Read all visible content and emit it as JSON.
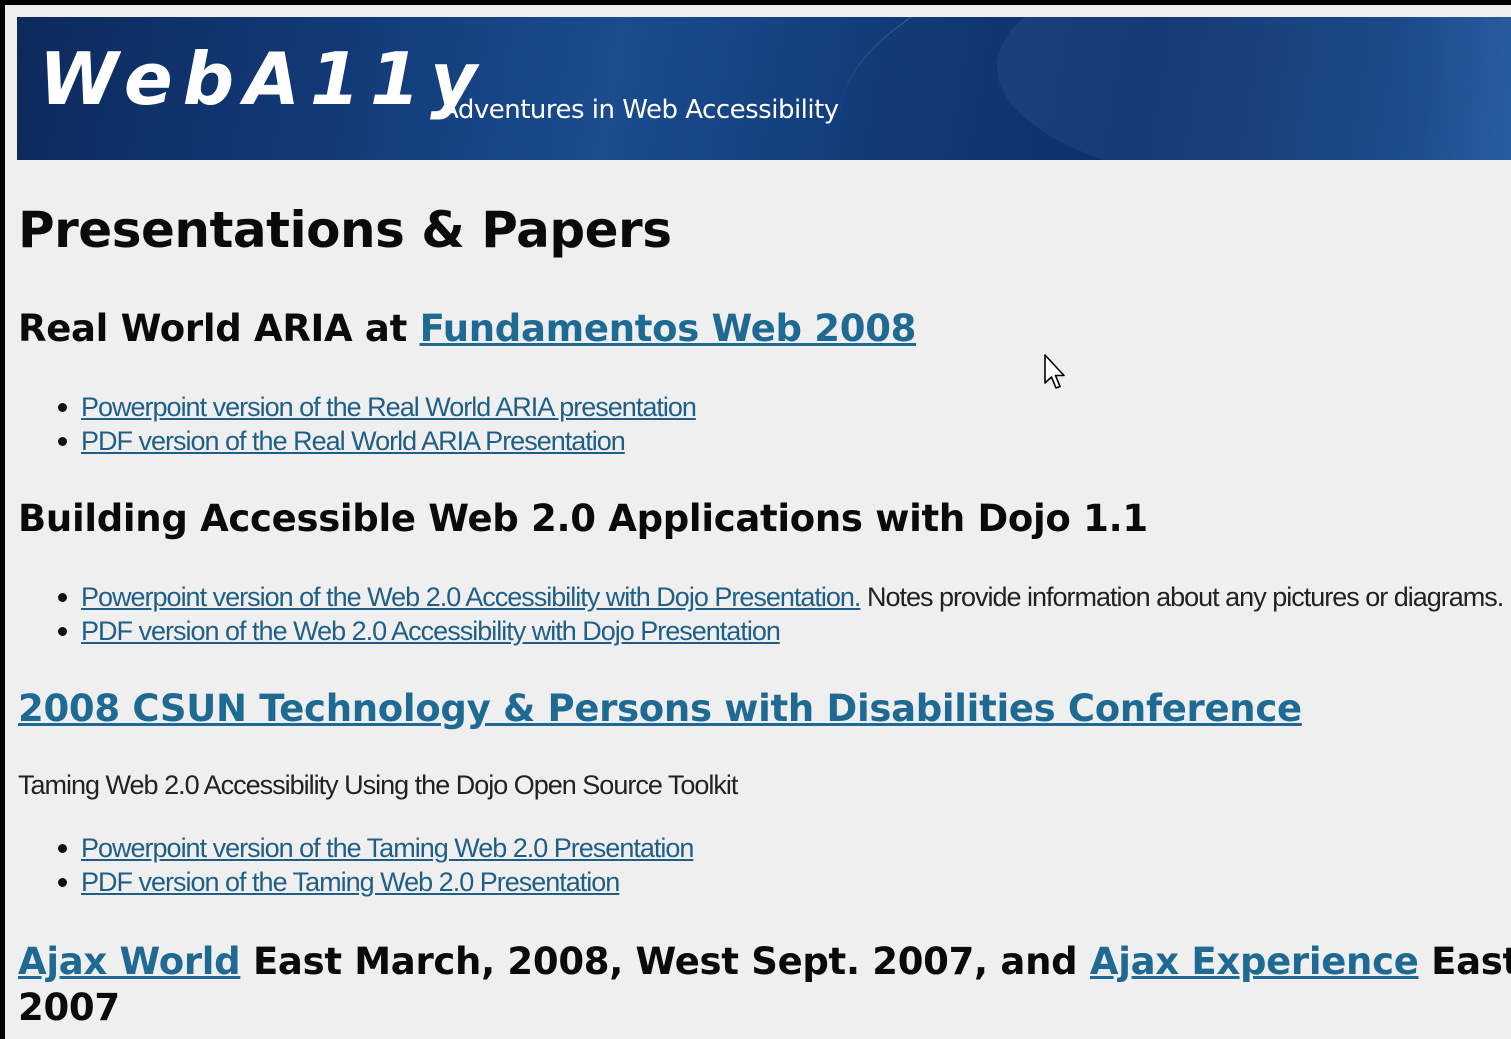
{
  "header": {
    "logo_text": "WebA11y",
    "tagline": "Adventures in Web Accessibility"
  },
  "page_title": "Presentations & Papers",
  "sections": [
    {
      "heading_prefix": "Real World ARIA at ",
      "heading_link": "Fundamentos Web 2008",
      "items": [
        {
          "link": "Powerpoint version of the Real World ARIA presentation",
          "trailing": ""
        },
        {
          "link": "PDF version of the Real World ARIA Presentation",
          "trailing": ""
        }
      ]
    },
    {
      "heading": "Building Accessible Web 2.0 Applications with Dojo 1.1",
      "items": [
        {
          "link": "Powerpoint version of the Web 2.0 Accessibility with Dojo Presentation.",
          "trailing": " Notes provide information about any pictures or diagrams."
        },
        {
          "link": "PDF version of the Web 2.0 Accessibility with Dojo Presentation",
          "trailing": ""
        }
      ]
    },
    {
      "heading_link": "2008 CSUN Technology & Persons with Disabilities Conference",
      "description": "Taming Web 2.0 Accessibility Using the Dojo Open Source Toolkit",
      "items": [
        {
          "link": "Powerpoint version of the Taming Web 2.0 Presentation",
          "trailing": ""
        },
        {
          "link": "PDF version of the Taming Web 2.0 Presentation",
          "trailing": ""
        }
      ]
    },
    {
      "heading_link_1": "Ajax World",
      "heading_text_1": " East March, 2008, West Sept. 2007, and ",
      "heading_link_2": "Ajax Experience",
      "heading_text_2": " East Oct.",
      "heading_line_2": "2007"
    }
  ],
  "colors": {
    "link": "#1f5f86",
    "banner": "#123a78",
    "background": "#efefef"
  },
  "icons": {
    "cursor": "mouse-pointer-icon"
  }
}
